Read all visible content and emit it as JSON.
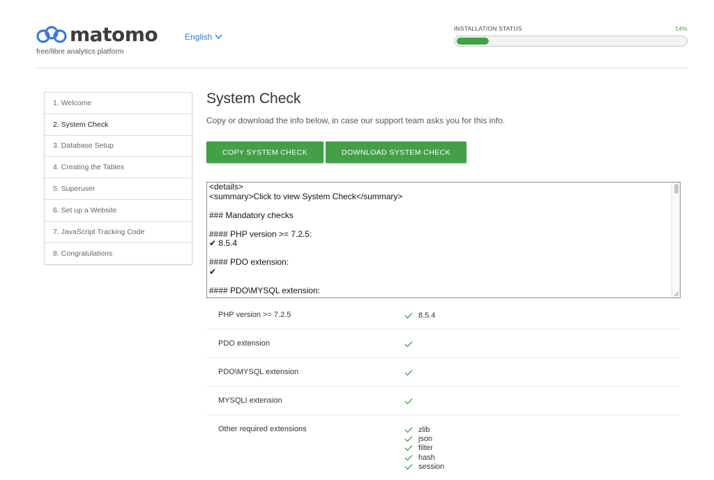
{
  "header": {
    "logo_text": "matomo",
    "tagline": "free/libre analytics platform",
    "language": "English",
    "status_label": "INSTALLATION STATUS",
    "status_percent": "14%",
    "progress_fraction": 0.14,
    "accent_color": "#43a047"
  },
  "steps": [
    {
      "label": "1. Welcome",
      "active": false
    },
    {
      "label": "2. System Check",
      "active": true
    },
    {
      "label": "3. Database Setup",
      "active": false
    },
    {
      "label": "4. Creating the Tables",
      "active": false
    },
    {
      "label": "5. Superuser",
      "active": false
    },
    {
      "label": "6. Set up a Website",
      "active": false
    },
    {
      "label": "7. JavaScript Tracking Code",
      "active": false
    },
    {
      "label": "8. Congratulations",
      "active": false
    }
  ],
  "main": {
    "title": "System Check",
    "description": "Copy or download the info below, in case our support team asks you for this info.",
    "copy_button": "COPY SYSTEM CHECK",
    "download_button": "DOWNLOAD SYSTEM CHECK",
    "textarea_lines": [
      "<details>",
      "<summary>Click to view System Check</summary>",
      "",
      "### Mandatory checks",
      "",
      "#### PHP version >= 7.2.5:",
      "✔ 8.5.4",
      "",
      "#### PDO extension:",
      "✔",
      "",
      "#### PDO\\MYSQL extension:"
    ],
    "checks": [
      {
        "name": "PHP version >= 7.2.5",
        "values": [
          "8.5.4"
        ]
      },
      {
        "name": "PDO extension",
        "values": [
          ""
        ]
      },
      {
        "name": "PDO\\MYSQL extension",
        "values": [
          ""
        ]
      },
      {
        "name": "MYSQLI extension",
        "values": [
          ""
        ]
      },
      {
        "name": "Other required extensions",
        "values": [
          "zlib",
          "json",
          "filter",
          "hash",
          "session"
        ]
      }
    ]
  }
}
